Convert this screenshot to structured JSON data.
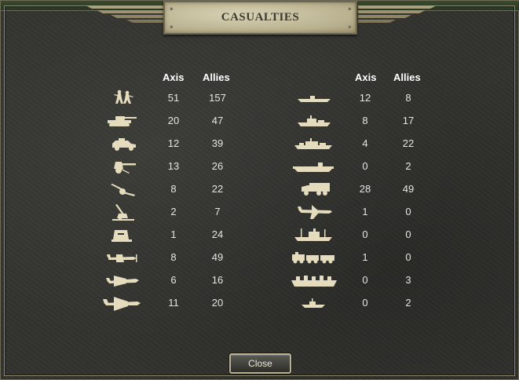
{
  "dialog": {
    "title": "CASUALTIES",
    "close_label": "Close"
  },
  "columns": {
    "axis": "Axis",
    "allies": "Allies"
  },
  "colors": {
    "icon": "#e5dcbd",
    "text": "#e6e6e0",
    "header": "#ffffff"
  },
  "left_rows": [
    {
      "icon": "infantry-icon",
      "axis": "51",
      "allies": "157"
    },
    {
      "icon": "tank-icon",
      "axis": "20",
      "allies": "47"
    },
    {
      "icon": "armored-car-icon",
      "axis": "12",
      "allies": "39"
    },
    {
      "icon": "anti-tank-gun-icon",
      "axis": "13",
      "allies": "26"
    },
    {
      "icon": "artillery-icon",
      "axis": "8",
      "allies": "22"
    },
    {
      "icon": "anti-aircraft-gun-icon",
      "axis": "2",
      "allies": "7"
    },
    {
      "icon": "bunker-icon",
      "axis": "1",
      "allies": "24"
    },
    {
      "icon": "fighter-plane-icon",
      "axis": "8",
      "allies": "49"
    },
    {
      "icon": "tactical-bomber-icon",
      "axis": "6",
      "allies": "16"
    },
    {
      "icon": "strategic-bomber-icon",
      "axis": "11",
      "allies": "20"
    }
  ],
  "right_rows": [
    {
      "icon": "submarine-icon",
      "axis": "12",
      "allies": "8"
    },
    {
      "icon": "destroyer-icon",
      "axis": "8",
      "allies": "17"
    },
    {
      "icon": "cruiser-icon",
      "axis": "4",
      "allies": "22"
    },
    {
      "icon": "carrier-icon",
      "axis": "0",
      "allies": "2"
    },
    {
      "icon": "truck-icon",
      "axis": "28",
      "allies": "49"
    },
    {
      "icon": "transport-plane-icon",
      "axis": "1",
      "allies": "0"
    },
    {
      "icon": "transport-ship-icon",
      "axis": "0",
      "allies": "0"
    },
    {
      "icon": "armored-train-icon",
      "axis": "1",
      "allies": "0"
    },
    {
      "icon": "landing-craft-icon",
      "axis": "0",
      "allies": "3"
    },
    {
      "icon": "patrol-boat-icon",
      "axis": "0",
      "allies": "2"
    }
  ]
}
